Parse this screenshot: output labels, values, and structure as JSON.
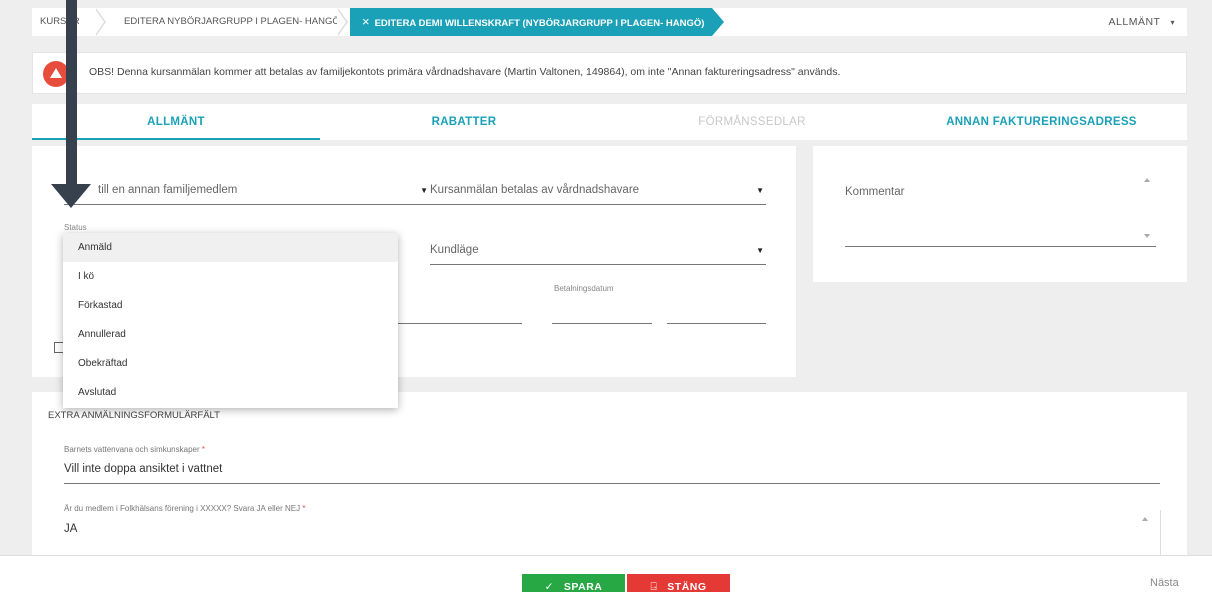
{
  "breadcrumb": {
    "items": [
      "KURSER",
      "EDITERA NYBÖRJARGRUPP I PLAGEN- HANGÖ"
    ],
    "active": "EDITERA DEMI WILLENSKRAFT (NYBÖRJARGRUPP I PLAGEN- HANGÖ)",
    "close_icon": "×",
    "right_menu": "ALLMÄNT",
    "caret": "▾"
  },
  "alert": {
    "icon": "warning-icon",
    "message": "OBS! Denna kursanmälan kommer att betalas av familjekontots primära vårdnadshavare (Martin Valtonen, 149864), om inte \"Annan faktureringsadress\" används."
  },
  "tabs": [
    {
      "label": "ALLMÄNT",
      "active": true
    },
    {
      "label": "RABATTER",
      "active": false
    },
    {
      "label": "FÖRMÅNSSEDLAR",
      "active": false,
      "disabled": true
    },
    {
      "label": "ANNAN FAKTURERINGSADRESS",
      "active": false
    }
  ],
  "form": {
    "family_member_field": "till en annan familjemedlem",
    "payer_field": "Kursanmälan betalas av vårdnadshavare",
    "status_label": "Status",
    "customer_mode_field": "Kundläge",
    "payment_date_label": "Betalningsdatum",
    "comment_placeholder": "Kommentar",
    "dropdown_caret": "▼"
  },
  "status_dropdown": {
    "options": [
      "Anmäld",
      "I kö",
      "Förkastad",
      "Annullerad",
      "Obekräftad",
      "Avslutad"
    ],
    "selected": "Anmäld"
  },
  "extra_fields": {
    "section_title": "EXTRA ANMÄLNINGSFORMULÄRFÄLT",
    "q1_label": "Barnets vattenvana och simkunskaper",
    "q1_value": "Vill inte doppa ansiktet i vattnet",
    "q2_label": "Är du medlem i Folkhälsans förening i XXXXX? Svara JA eller NEJ",
    "q2_value": "JA",
    "required_star": "*"
  },
  "footer": {
    "save_label": "SPARA",
    "save_icon": "✓",
    "close_label": "STÄNG",
    "close_icon": "⍈",
    "next_label": "Nästa"
  },
  "colors": {
    "accent": "#1aa0b7",
    "save": "#28a745",
    "close": "#e53935",
    "warning": "#e74c3c"
  }
}
